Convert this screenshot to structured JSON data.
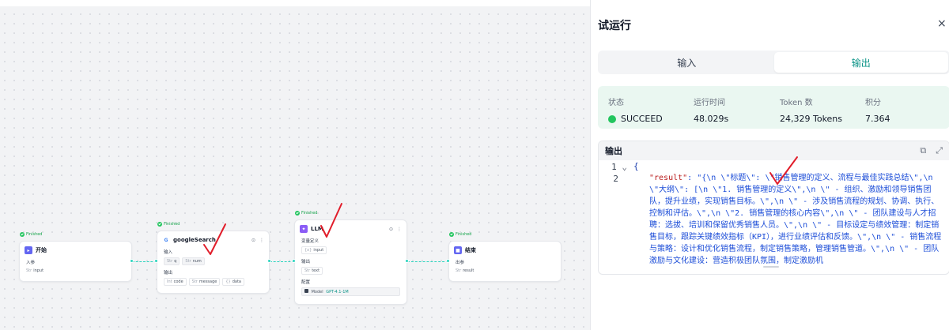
{
  "nodes": {
    "start": {
      "status": "Finished",
      "title": "开始",
      "section_label": "入参",
      "params": [
        {
          "type": "Str",
          "name": "input"
        }
      ]
    },
    "search": {
      "status": "Finished",
      "title": "googleSearch",
      "input_label": "输入",
      "inputs": [
        {
          "type": "Str",
          "name": "q"
        },
        {
          "type": "Str",
          "name": "num"
        }
      ],
      "output_label": "输出",
      "outputs": [
        {
          "type": "Int",
          "name": "code"
        },
        {
          "type": "Str",
          "name": "message"
        },
        {
          "type": "{}",
          "name": "data"
        }
      ]
    },
    "llm": {
      "status": "Finished",
      "title": "LLM",
      "vars_label": "变量定义",
      "vars": [
        {
          "type": "{x}",
          "name": "input"
        }
      ],
      "output_label": "输出",
      "outputs": [
        {
          "type": "Str",
          "name": "text"
        }
      ],
      "config_label": "配置",
      "model_label": "Model",
      "model_value": "GPT-4.1-1M"
    },
    "end": {
      "status": "Finished",
      "title": "结束",
      "section_label": "出参",
      "params": [
        {
          "type": "Str",
          "name": "result"
        }
      ]
    }
  },
  "panel": {
    "title": "试运行",
    "close": "×",
    "tabs": [
      {
        "label": "输入"
      },
      {
        "label": "输出"
      }
    ],
    "status": {
      "state_label": "状态",
      "state_value": "SUCCEED",
      "time_label": "运行时间",
      "time_value": "48.029s",
      "token_label": "Token 数",
      "token_value": "24,329 Tokens",
      "points_label": "积分",
      "points_value": "7.364"
    },
    "output": {
      "title": "输出",
      "line_numbers": [
        "1",
        "2"
      ],
      "line1": "{",
      "key": "\"result\"",
      "value_text": ": \"{\\n  \\\"标题\\\": \\\"销售管理的定义、流程与最佳实践总结\\\",\\n  \\\"大纲\\\": [\\n    \\\"1. 销售管理的定义\\\",\\n    \\\"   - 组织、激励和领导销售团队，提升业绩，实现销售目标。\\\",\\n    \\\"   - 涉及销售流程的规划、协调、执行、控制和评估。\\\",\\n    \\\"2. 销售管理的核心内容\\\",\\n    \\\"   - 团队建设与人才招聘：选拔、培训和保留优秀销售人员。\\\",\\n    \\\"   - 目标设定与绩效管理：制定销售目标，跟踪关键绩效指标（KPI），进行业绩评估和反馈。\\\",\\n    \\\"   - 销售流程与策略：设计和优化销售流程，制定销售策略，管理销售管道。\\\",\\n    \\\"   - 团队激励与文化建设：营造积极团队氛围，制定激励机"
    }
  },
  "colors": {
    "accent": "#0d9488",
    "success": "#22c55e",
    "connector": "#2dd4bf",
    "annotation": "#e11d2a"
  }
}
